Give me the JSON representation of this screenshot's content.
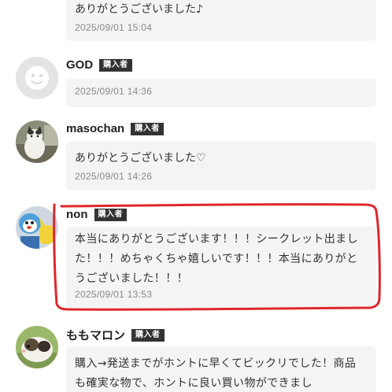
{
  "comments": [
    {
      "username": "",
      "badge": "",
      "text": "ありがとうございました♪",
      "date": "2025/09/01 15:04",
      "avatar": "none"
    },
    {
      "username": "GOD",
      "badge": "購入者",
      "text": "",
      "date": "2025/09/01 14:36",
      "avatar": "default-user-icon"
    },
    {
      "username": "masochan",
      "badge": "購入者",
      "text": "ありがとうございました♡",
      "date": "2025/09/01 14:26",
      "avatar": "cat-photo"
    },
    {
      "username": "non",
      "badge": "購入者",
      "text": "本当にありがとうございます！！！シークレット出ました！！！めちゃくちゃ嬉しいです！！！本当にありがとうございました！！！",
      "date": "2025/09/01 13:53",
      "avatar": "toy-photo"
    },
    {
      "username": "ももマロン",
      "badge": "購入者",
      "text": "購入→発送までがホントに早くてビックリでした！商品も確実な物で、ホントに良い買い物ができまし",
      "date": "",
      "avatar": "guinea-pig-photo"
    }
  ],
  "colors": {
    "bubble": "#f4f4f4",
    "badge": "#333333",
    "annotation": "#e0262a"
  }
}
